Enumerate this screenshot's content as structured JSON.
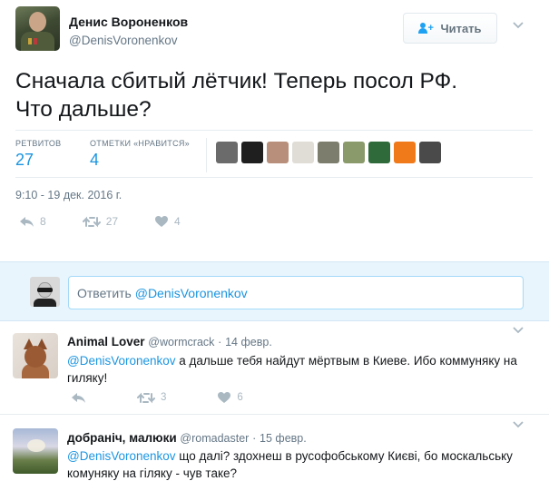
{
  "colors": {
    "link_blue": "#1b95e0",
    "muted_gray": "#657786",
    "action_gray": "#aab8c2",
    "reply_bg": "#e8f5fd"
  },
  "tweet": {
    "author_name": "Денис Вороненков",
    "author_handle": "@DenisVoronenkov",
    "follow_label": "Читать",
    "text_line1": "Сначала сбитый лётчик! Теперь посол РФ.",
    "text_line2": "Что дальше?",
    "stats": {
      "retweets_label": "РЕТВИТОВ",
      "retweets_value": "27",
      "likes_label": "ОТМЕТКИ «НРАВИТСЯ»",
      "likes_value": "4"
    },
    "likers": [
      {
        "icon": "liker-avatar-1",
        "color": "#6b6b6b"
      },
      {
        "icon": "liker-avatar-2",
        "color": "#1f1f1f"
      },
      {
        "icon": "liker-avatar-3",
        "color": "#b88f7a"
      },
      {
        "icon": "liker-avatar-4",
        "color": "#e0ddd6"
      },
      {
        "icon": "liker-avatar-5",
        "color": "#7d7d6d"
      },
      {
        "icon": "liker-avatar-6",
        "color": "#8a9a6a"
      },
      {
        "icon": "liker-avatar-7",
        "color": "#2f6b3a"
      },
      {
        "icon": "liker-avatar-8",
        "color": "#f07a1a"
      },
      {
        "icon": "liker-avatar-9",
        "color": "#4a4a4a"
      }
    ],
    "timestamp": "9:10 - 19 дек. 2016 г.",
    "actions": {
      "reply_count": "8",
      "retweet_count": "27",
      "like_count": "4"
    }
  },
  "reply_box": {
    "prompt": "Ответить ",
    "mention": "@DenisVoronenkov"
  },
  "replies": [
    {
      "name": "Animal Lover",
      "handle": "@wormcrack",
      "dot": "·",
      "date": "14 февр.",
      "mention": "@DenisVoronenkov",
      "text": " а дальше тебя найдут мёртвым в Киеве. Ибо коммуняку на гиляку!",
      "retweet_count": "3",
      "like_count": "6"
    },
    {
      "name": "добраніч, малюки",
      "handle": "@romadaster",
      "dot": "·",
      "date": "15 февр.",
      "mention": "@DenisVoronenkov",
      "text": " що далі? здохнеш в русофобському Києві, бо москальську комуняку на гіляку - чув таке?"
    }
  ]
}
